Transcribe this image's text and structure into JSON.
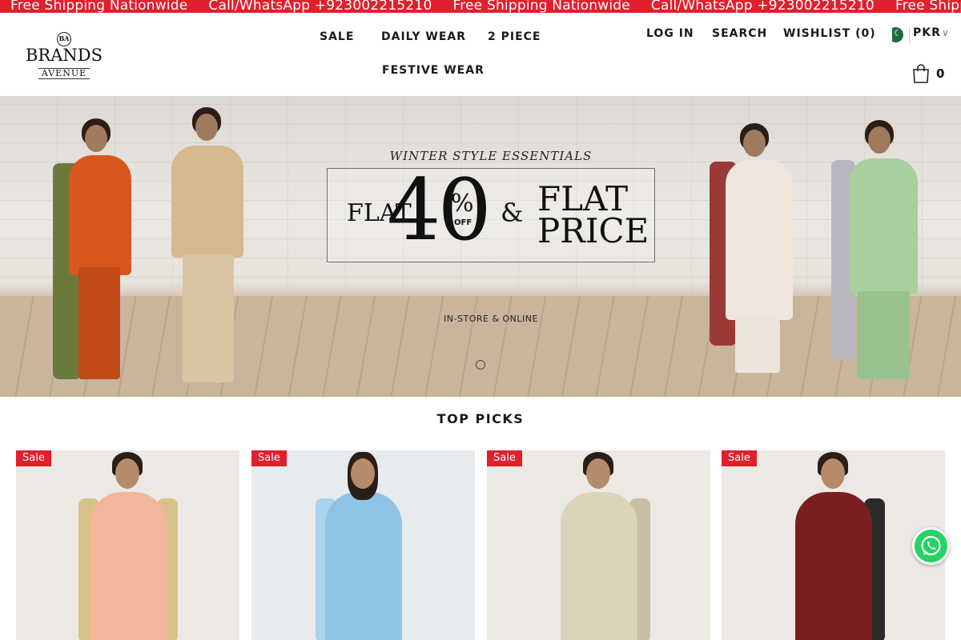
{
  "announcement": {
    "items": [
      "Free Shipping Nationwide",
      "Call/WhatsApp +923002215210",
      "Free Shipping Nationwide",
      "Call/WhatsApp +923002215210",
      "Free Shipping Nationwide"
    ],
    "background": "#e0202c"
  },
  "header": {
    "logo": {
      "line1": "BRANDS",
      "line2": "AVENUE",
      "crest": "BA"
    },
    "nav": [
      "SALE",
      "DAILY WEAR",
      "2 PIECE",
      "FESTIVE WEAR"
    ],
    "utility": {
      "login": "LOG IN",
      "search": "SEARCH",
      "wishlist": "WISHLIST (0)",
      "currency": "PKR",
      "cart_count": "0"
    }
  },
  "hero": {
    "kicker": "WINTER STYLE ESSENTIALS",
    "flat_left": "FLAT",
    "big_number": "40",
    "percent": "%",
    "off": "OFF",
    "ampersand": "&",
    "flat_right": "FLAT",
    "price": "PRICE",
    "subtitle": "IN-STORE & ONLINE"
  },
  "top_picks": {
    "title": "TOP PICKS",
    "products": [
      {
        "badge": "Sale",
        "colors": [
          "#f2b79a",
          "#e7a07f",
          "#d9c28a"
        ]
      },
      {
        "badge": "Sale",
        "colors": [
          "#8fc3e6",
          "#a9d3ef",
          "#6aa8d6"
        ]
      },
      {
        "badge": "Sale",
        "colors": [
          "#dcd3bb",
          "#c7bfa4",
          "#d89aa8"
        ]
      },
      {
        "badge": "Sale",
        "colors": [
          "#7a1f1f",
          "#5a1616",
          "#2a2a2a"
        ]
      }
    ]
  },
  "whatsapp": {
    "icon": "whatsapp-icon",
    "color": "#25d366"
  }
}
